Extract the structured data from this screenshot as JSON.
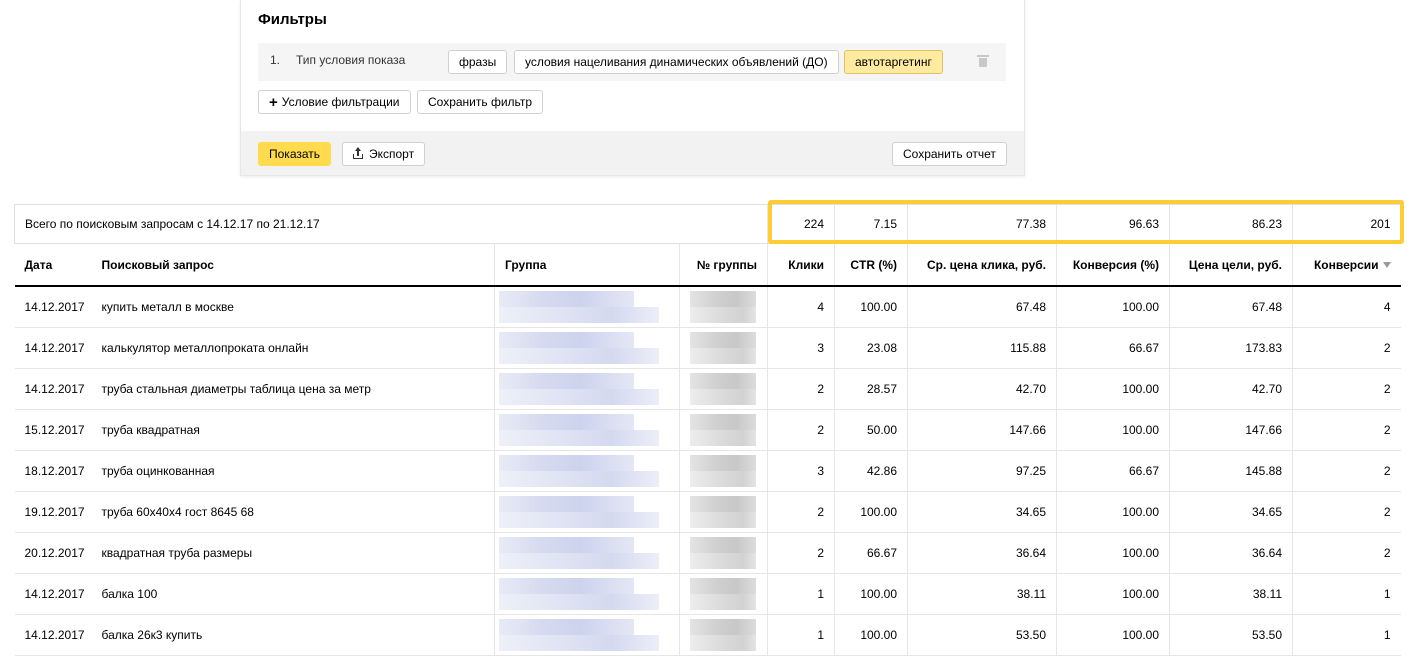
{
  "filters": {
    "title": "Фильтры",
    "condition": {
      "number": "1.",
      "label": "Тип условия показа",
      "chips": [
        "фразы",
        "условия нацеливания динамических объявлений (ДО)",
        "автотаргетинг"
      ]
    },
    "add_condition_label": "Условие фильтрации",
    "save_filter_label": "Сохранить фильтр",
    "show_label": "Показать",
    "export_label": "Экспорт",
    "save_report_label": "Сохранить отчет"
  },
  "report": {
    "summary_label": "Всего по поисковым запросам с 14.12.17 по 21.12.17",
    "totals": {
      "clicks": "224",
      "ctr": "7.15",
      "avg_cpc": "77.38",
      "conversion_rate": "96.63",
      "goal_cost": "86.23",
      "conversions": "201"
    },
    "columns": {
      "date": "Дата",
      "query": "Поисковый запрос",
      "group": "Группа",
      "group_no": "№ группы",
      "clicks": "Клики",
      "ctr": "CTR (%)",
      "avg_cpc": "Ср. цена клика, руб.",
      "conversion_rate": "Конверсия (%)",
      "goal_cost": "Цена цели, руб.",
      "conversions": "Конверсии"
    },
    "rows": [
      {
        "date": "14.12.2017",
        "query": "купить металл в москве",
        "clicks": "4",
        "ctr": "100.00",
        "avg_cpc": "67.48",
        "conversion_rate": "100.00",
        "goal_cost": "67.48",
        "conversions": "4"
      },
      {
        "date": "14.12.2017",
        "query": "калькулятор металлопроката онлайн",
        "clicks": "3",
        "ctr": "23.08",
        "avg_cpc": "115.88",
        "conversion_rate": "66.67",
        "goal_cost": "173.83",
        "conversions": "2"
      },
      {
        "date": "14.12.2017",
        "query": "труба стальная диаметры таблица цена за метр",
        "clicks": "2",
        "ctr": "28.57",
        "avg_cpc": "42.70",
        "conversion_rate": "100.00",
        "goal_cost": "42.70",
        "conversions": "2"
      },
      {
        "date": "15.12.2017",
        "query": "труба квадратная",
        "clicks": "2",
        "ctr": "50.00",
        "avg_cpc": "147.66",
        "conversion_rate": "100.00",
        "goal_cost": "147.66",
        "conversions": "2"
      },
      {
        "date": "18.12.2017",
        "query": "труба оцинкованная",
        "clicks": "3",
        "ctr": "42.86",
        "avg_cpc": "97.25",
        "conversion_rate": "66.67",
        "goal_cost": "145.88",
        "conversions": "2"
      },
      {
        "date": "19.12.2017",
        "query": "труба 60х40х4 гост 8645 68",
        "clicks": "2",
        "ctr": "100.00",
        "avg_cpc": "34.65",
        "conversion_rate": "100.00",
        "goal_cost": "34.65",
        "conversions": "2"
      },
      {
        "date": "20.12.2017",
        "query": "квадратная труба размеры",
        "clicks": "2",
        "ctr": "66.67",
        "avg_cpc": "36.64",
        "conversion_rate": "100.00",
        "goal_cost": "36.64",
        "conversions": "2"
      },
      {
        "date": "14.12.2017",
        "query": "балка 100",
        "clicks": "1",
        "ctr": "100.00",
        "avg_cpc": "38.11",
        "conversion_rate": "100.00",
        "goal_cost": "38.11",
        "conversions": "1"
      },
      {
        "date": "14.12.2017",
        "query": "балка 26к3 купить",
        "clicks": "1",
        "ctr": "100.00",
        "avg_cpc": "53.50",
        "conversion_rate": "100.00",
        "goal_cost": "53.50",
        "conversions": "1"
      }
    ]
  },
  "colors": {
    "accent_yellow": "#ffdb4d",
    "highlight_border": "#ffcc33"
  }
}
